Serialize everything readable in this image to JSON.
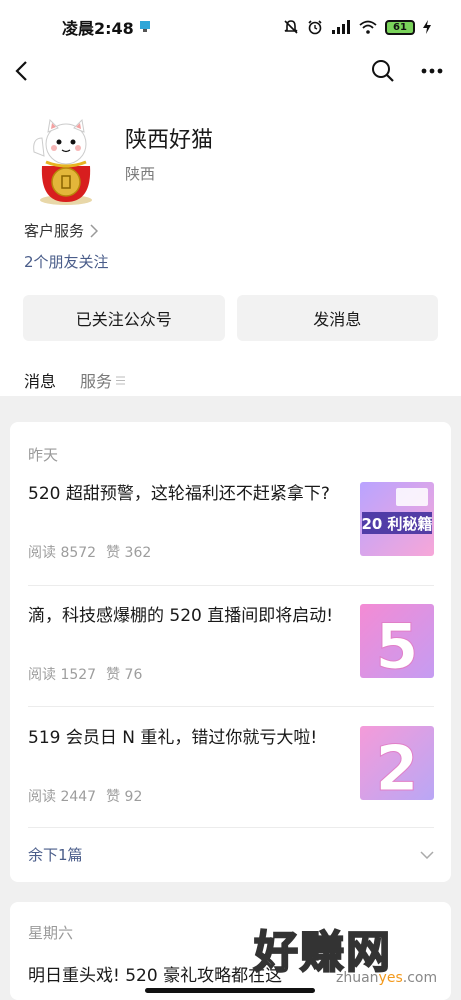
{
  "status_bar": {
    "time": "凌晨2:48",
    "battery": "61"
  },
  "profile": {
    "name": "陕西好猫",
    "region": "陕西",
    "service_label": "客户服务",
    "friends_follow": "2个朋友关注"
  },
  "actions": {
    "followed_label": "已关注公众号",
    "message_label": "发消息"
  },
  "tabs": [
    {
      "label": "消息"
    },
    {
      "label": "服务"
    }
  ],
  "feed": {
    "groups": [
      {
        "date": "昨天",
        "articles": [
          {
            "title": "520 超甜预警，这轮福利还不赶紧拿下?",
            "read": "阅读 8572",
            "like": "赞 362",
            "thumb_text": "20 利秘籍"
          },
          {
            "title": "滴，科技感爆棚的 520 直播间即将启动!",
            "read": "阅读 1527",
            "like": "赞 76",
            "thumb_text": "5"
          },
          {
            "title": "519 会员日 N 重礼，错过你就亏大啦!",
            "read": "阅读 2447",
            "like": "赞 92",
            "thumb_text": "2"
          }
        ],
        "more_label": "余下1篇"
      },
      {
        "date": "星期六",
        "articles": [
          {
            "title": "明日重头戏! 520 豪礼攻略都在这"
          }
        ]
      }
    ]
  },
  "watermark": {
    "brand": "好赚网",
    "url_prefix": "zhuan",
    "url_highlight": "yes",
    "url_suffix": ".com"
  },
  "colors": {
    "link": "#4a5d8a",
    "feed_bg": "#f0f0f0",
    "button_bg": "#f2f2f2"
  }
}
